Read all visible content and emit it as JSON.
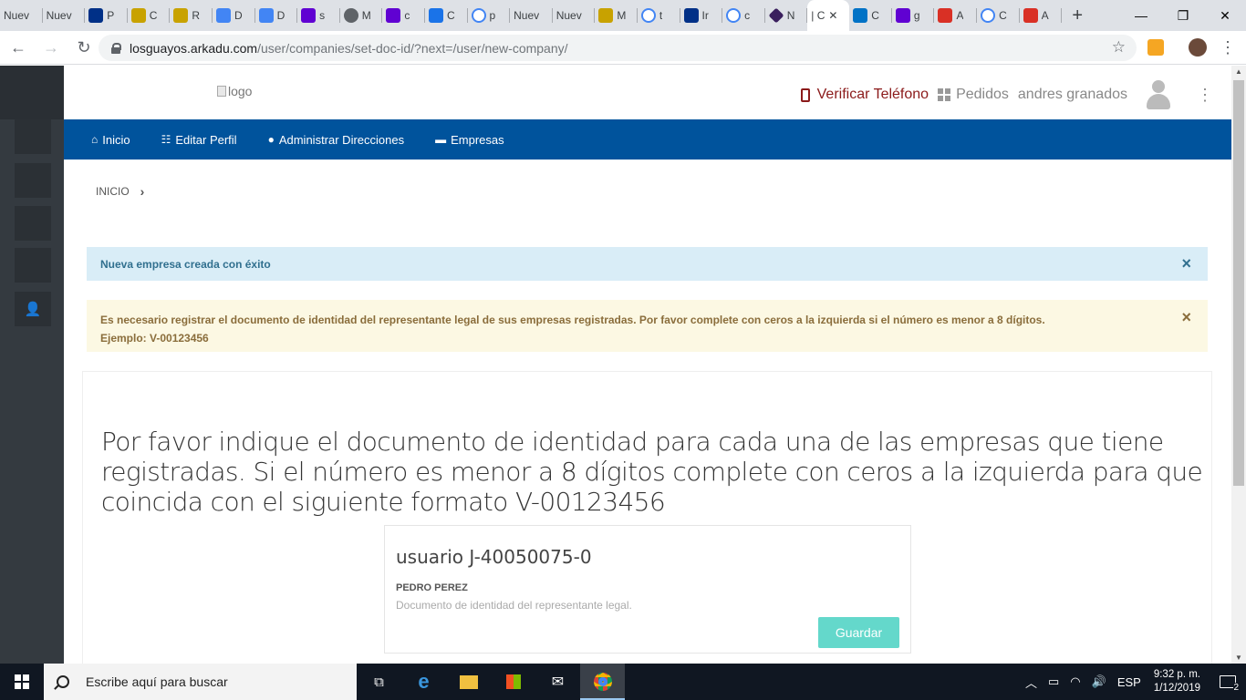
{
  "browser": {
    "tabs": [
      {
        "title": "Nuev",
        "fav": "none",
        "color": "#dee1e6"
      },
      {
        "title": "Nuev",
        "fav": "none",
        "color": "#dee1e6"
      },
      {
        "title": "P",
        "fav": "paypal",
        "color": "#003087"
      },
      {
        "title": "C",
        "fav": "flag",
        "color": "#c8a200"
      },
      {
        "title": "R",
        "fav": "flag",
        "color": "#c8a200"
      },
      {
        "title": "D",
        "fav": "docs",
        "color": "#4285f4"
      },
      {
        "title": "D",
        "fav": "docs",
        "color": "#4285f4"
      },
      {
        "title": "s",
        "fav": "yahoo",
        "color": "#6001d2"
      },
      {
        "title": "M",
        "fav": "globe",
        "color": "#5f6368"
      },
      {
        "title": "c",
        "fav": "yahoo",
        "color": "#6001d2"
      },
      {
        "title": "C",
        "fav": "gear",
        "color": "#1a73e8"
      },
      {
        "title": "p",
        "fav": "google",
        "color": "#4285f4"
      },
      {
        "title": "Nuev",
        "fav": "none",
        "color": "#dee1e6"
      },
      {
        "title": "Nuev",
        "fav": "none",
        "color": "#dee1e6"
      },
      {
        "title": "M",
        "fav": "flag",
        "color": "#c8a200"
      },
      {
        "title": "t",
        "fav": "google",
        "color": "#4285f4"
      },
      {
        "title": "Ir",
        "fav": "paypal",
        "color": "#003087"
      },
      {
        "title": "c",
        "fav": "google",
        "color": "#4285f4"
      },
      {
        "title": "N",
        "fav": "diamond",
        "color": "#3a1f5d"
      }
    ],
    "active_tab": {
      "title": "| C",
      "close": "✕"
    },
    "tabs_after": [
      {
        "title": "C",
        "fav": "outlook",
        "color": "#0072c6"
      },
      {
        "title": "g",
        "fav": "yahoo",
        "color": "#6001d2"
      },
      {
        "title": "A",
        "fav": "gmail",
        "color": "#d93025"
      },
      {
        "title": "C",
        "fav": "google",
        "color": "#4285f4"
      },
      {
        "title": "A",
        "fav": "gmail",
        "color": "#d93025"
      }
    ],
    "new_tab": "+",
    "url_host": "losguayos.arkadu.com",
    "url_path": "/user/companies/set-doc-id/?next=/user/new-company/"
  },
  "header": {
    "logo_alt": "logo",
    "verify_phone": "Verificar Teléfono",
    "orders": "Pedidos",
    "username": "andres granados"
  },
  "nav": {
    "items": [
      {
        "label": "Inicio",
        "icon": "home-icon"
      },
      {
        "label": "Editar Perfil",
        "icon": "sitemap-icon"
      },
      {
        "label": "Administrar Direcciones",
        "icon": "map-marker-icon"
      },
      {
        "label": "Empresas",
        "icon": "briefcase-icon"
      }
    ]
  },
  "breadcrumb": {
    "home": "INICIO"
  },
  "alerts": {
    "success": "Nueva empresa creada con éxito",
    "warning_line1": "Es necesario registrar el documento de identidad del representante legal de sus empresas registradas. Por favor complete con ceros a la izquierda si el número es menor a 8 dígitos.",
    "warning_line2": "Ejemplo: V-00123456",
    "close": "×"
  },
  "main": {
    "instructions": "Por favor indique el documento de identidad para cada una de las empresas que tiene registradas. Si el número es menor a 8 dígitos complete con ceros a la izquierda para que coincida con el siguiente formato V-00123456",
    "company": {
      "title": "usuario J-40050075-0",
      "rep_name": "PEDRO PEREZ",
      "input_placeholder": "Documento de identidad del representante legal.",
      "save_label": "Guardar"
    }
  },
  "taskbar": {
    "search_placeholder": "Escribe aquí para buscar",
    "language": "ESP",
    "time": "9:32 p. m.",
    "date": "1/12/2019",
    "notifications": "2"
  }
}
